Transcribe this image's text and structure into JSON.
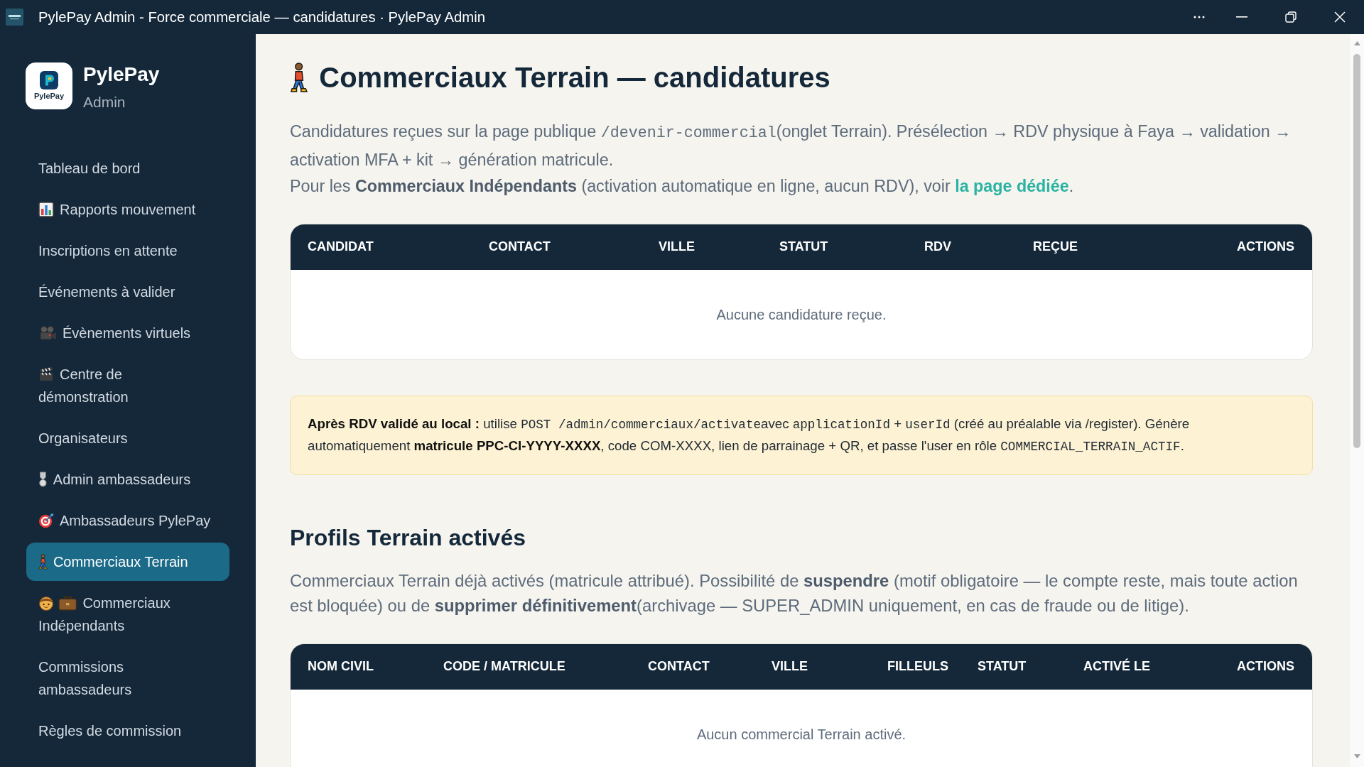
{
  "window": {
    "title": "PylePay Admin - Force commerciale — candidatures · PylePay Admin"
  },
  "sidebar": {
    "brand": {
      "logo_text": "PylePay",
      "name": "PylePay",
      "subtitle": "Admin"
    },
    "items": [
      {
        "label": "Tableau de bord",
        "selected": false
      },
      {
        "label": "Rapports mouvement",
        "selected": false
      },
      {
        "label": "Inscriptions en attente",
        "selected": false
      },
      {
        "label": "Événements à valider",
        "selected": false
      },
      {
        "label": "Évènements virtuels",
        "selected": false
      },
      {
        "label": "Centre de démonstration",
        "selected": false
      },
      {
        "label": "Organisateurs",
        "selected": false
      },
      {
        "label": "Admin ambassadeurs",
        "selected": false
      },
      {
        "label": "Ambassadeurs PylePay",
        "selected": false
      },
      {
        "label": "Commerciaux Terrain",
        "selected": true
      },
      {
        "label": "Commerciaux Indépendants",
        "selected": false
      },
      {
        "label": "Commissions ambassadeurs",
        "selected": false
      },
      {
        "label": "Règles de commission",
        "selected": false
      }
    ]
  },
  "page": {
    "title": "Commerciaux Terrain — candidatures",
    "intro": [
      {
        "kind": "text",
        "text": "Candidatures reçues sur la page publique "
      },
      {
        "kind": "code",
        "text": "/devenir-commercial"
      },
      {
        "kind": "text",
        "text": "(onglet Terrain). Présélection → RDV physique à Faya → validation → activation MFA + kit → génération matricule."
      }
    ],
    "note": [
      {
        "kind": "text",
        "text": "Pour les "
      },
      {
        "kind": "bold",
        "text": "Commerciaux Indépendants"
      },
      {
        "kind": "text",
        "text": " (activation automatique en ligne, aucun RDV), voir "
      },
      {
        "kind": "link",
        "text": "la page dédiée"
      },
      {
        "kind": "text",
        "text": "."
      }
    ]
  },
  "applications_table": {
    "columns": [
      "CANDIDAT",
      "CONTACT",
      "VILLE",
      "STATUT",
      "RDV",
      "REÇUE",
      "ACTIONS"
    ],
    "empty_message": "Aucune candidature reçue."
  },
  "activation_notice": [
    {
      "kind": "bold",
      "text": "Après RDV validé au local :"
    },
    {
      "kind": "text",
      "text": " utilise "
    },
    {
      "kind": "code",
      "text": "POST /admin/commerciaux/activate"
    },
    {
      "kind": "text",
      "text": "avec "
    },
    {
      "kind": "code",
      "text": "applicationId"
    },
    {
      "kind": "text",
      "text": " + "
    },
    {
      "kind": "code",
      "text": "userId"
    },
    {
      "kind": "text",
      "text": " (créé au préalable via /register). Génère automatiquement "
    },
    {
      "kind": "bold",
      "text": "matricule PPC-CI-YYYY-XXXX"
    },
    {
      "kind": "text",
      "text": ", code COM-XXXX, lien de parrainage + QR, et passe l'user en rôle "
    },
    {
      "kind": "code",
      "text": "COMMERCIAL_TERRAIN_ACTIF"
    },
    {
      "kind": "text",
      "text": "."
    }
  ],
  "active_profiles": {
    "title": "Profils Terrain activés",
    "description": [
      {
        "kind": "text",
        "text": "Commerciaux Terrain déjà activés (matricule attribué). Possibilité de "
      },
      {
        "kind": "bold",
        "text": "suspendre"
      },
      {
        "kind": "text",
        "text": " (motif obligatoire — le compte reste, mais toute action est bloquée) ou de "
      },
      {
        "kind": "bold",
        "text": "supprimer définitivement"
      },
      {
        "kind": "text",
        "text": "(archivage — SUPER_ADMIN uniquement, en cas de fraude ou de litige)."
      }
    ],
    "table": {
      "columns": [
        "NOM CIVIL",
        "CODE / MATRICULE",
        "CONTACT",
        "VILLE",
        "FILLEULS",
        "STATUT",
        "ACTIVÉ LE",
        "ACTIONS"
      ],
      "empty_message": "Aucun commercial Terrain activé."
    }
  }
}
